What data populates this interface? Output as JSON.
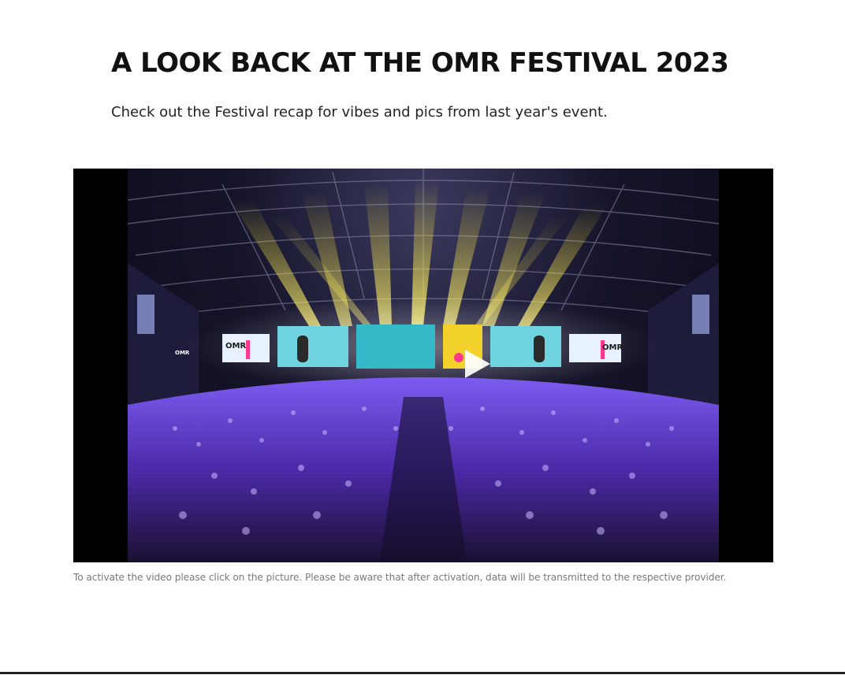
{
  "section": {
    "title": "A LOOK BACK AT THE OMR FESTIVAL 2023",
    "subtitle": "Check out the Festival recap for vibes and pics from last year's event."
  },
  "video": {
    "play_icon": "play-icon",
    "screen_logo_left": "OMR",
    "screen_logo_right": "OMR",
    "side_logo": "OMR",
    "caption": "To activate the video please click on the picture. Please be aware that after activation, data will be transmitted to the respective provider."
  },
  "colors": {
    "title": "#111111",
    "caption": "#7a7a7a",
    "video_bg": "#000000",
    "spotlight": "#f5e020",
    "crowd": "#6a3fd0"
  }
}
